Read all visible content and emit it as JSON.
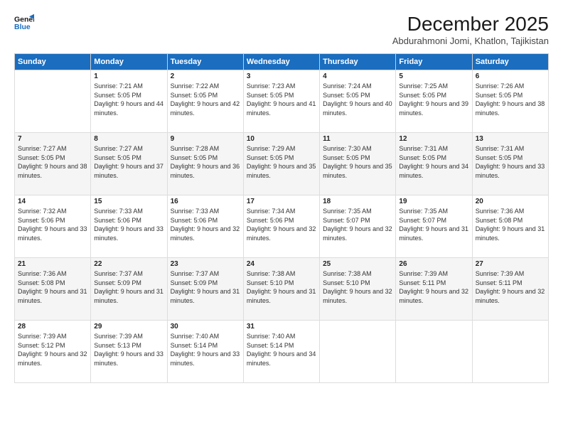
{
  "logo": {
    "line1": "General",
    "line2": "Blue"
  },
  "title": "December 2025",
  "location": "Abdurahmoni Jomi, Khatlon, Tajikistan",
  "weekdays": [
    "Sunday",
    "Monday",
    "Tuesday",
    "Wednesday",
    "Thursday",
    "Friday",
    "Saturday"
  ],
  "weeks": [
    [
      {
        "day": "",
        "sunrise": "",
        "sunset": "",
        "daylight": ""
      },
      {
        "day": "1",
        "sunrise": "Sunrise: 7:21 AM",
        "sunset": "Sunset: 5:05 PM",
        "daylight": "Daylight: 9 hours and 44 minutes."
      },
      {
        "day": "2",
        "sunrise": "Sunrise: 7:22 AM",
        "sunset": "Sunset: 5:05 PM",
        "daylight": "Daylight: 9 hours and 42 minutes."
      },
      {
        "day": "3",
        "sunrise": "Sunrise: 7:23 AM",
        "sunset": "Sunset: 5:05 PM",
        "daylight": "Daylight: 9 hours and 41 minutes."
      },
      {
        "day": "4",
        "sunrise": "Sunrise: 7:24 AM",
        "sunset": "Sunset: 5:05 PM",
        "daylight": "Daylight: 9 hours and 40 minutes."
      },
      {
        "day": "5",
        "sunrise": "Sunrise: 7:25 AM",
        "sunset": "Sunset: 5:05 PM",
        "daylight": "Daylight: 9 hours and 39 minutes."
      },
      {
        "day": "6",
        "sunrise": "Sunrise: 7:26 AM",
        "sunset": "Sunset: 5:05 PM",
        "daylight": "Daylight: 9 hours and 38 minutes."
      }
    ],
    [
      {
        "day": "7",
        "sunrise": "Sunrise: 7:27 AM",
        "sunset": "Sunset: 5:05 PM",
        "daylight": "Daylight: 9 hours and 38 minutes."
      },
      {
        "day": "8",
        "sunrise": "Sunrise: 7:27 AM",
        "sunset": "Sunset: 5:05 PM",
        "daylight": "Daylight: 9 hours and 37 minutes."
      },
      {
        "day": "9",
        "sunrise": "Sunrise: 7:28 AM",
        "sunset": "Sunset: 5:05 PM",
        "daylight": "Daylight: 9 hours and 36 minutes."
      },
      {
        "day": "10",
        "sunrise": "Sunrise: 7:29 AM",
        "sunset": "Sunset: 5:05 PM",
        "daylight": "Daylight: 9 hours and 35 minutes."
      },
      {
        "day": "11",
        "sunrise": "Sunrise: 7:30 AM",
        "sunset": "Sunset: 5:05 PM",
        "daylight": "Daylight: 9 hours and 35 minutes."
      },
      {
        "day": "12",
        "sunrise": "Sunrise: 7:31 AM",
        "sunset": "Sunset: 5:05 PM",
        "daylight": "Daylight: 9 hours and 34 minutes."
      },
      {
        "day": "13",
        "sunrise": "Sunrise: 7:31 AM",
        "sunset": "Sunset: 5:05 PM",
        "daylight": "Daylight: 9 hours and 33 minutes."
      }
    ],
    [
      {
        "day": "14",
        "sunrise": "Sunrise: 7:32 AM",
        "sunset": "Sunset: 5:06 PM",
        "daylight": "Daylight: 9 hours and 33 minutes."
      },
      {
        "day": "15",
        "sunrise": "Sunrise: 7:33 AM",
        "sunset": "Sunset: 5:06 PM",
        "daylight": "Daylight: 9 hours and 33 minutes."
      },
      {
        "day": "16",
        "sunrise": "Sunrise: 7:33 AM",
        "sunset": "Sunset: 5:06 PM",
        "daylight": "Daylight: 9 hours and 32 minutes."
      },
      {
        "day": "17",
        "sunrise": "Sunrise: 7:34 AM",
        "sunset": "Sunset: 5:06 PM",
        "daylight": "Daylight: 9 hours and 32 minutes."
      },
      {
        "day": "18",
        "sunrise": "Sunrise: 7:35 AM",
        "sunset": "Sunset: 5:07 PM",
        "daylight": "Daylight: 9 hours and 32 minutes."
      },
      {
        "day": "19",
        "sunrise": "Sunrise: 7:35 AM",
        "sunset": "Sunset: 5:07 PM",
        "daylight": "Daylight: 9 hours and 31 minutes."
      },
      {
        "day": "20",
        "sunrise": "Sunrise: 7:36 AM",
        "sunset": "Sunset: 5:08 PM",
        "daylight": "Daylight: 9 hours and 31 minutes."
      }
    ],
    [
      {
        "day": "21",
        "sunrise": "Sunrise: 7:36 AM",
        "sunset": "Sunset: 5:08 PM",
        "daylight": "Daylight: 9 hours and 31 minutes."
      },
      {
        "day": "22",
        "sunrise": "Sunrise: 7:37 AM",
        "sunset": "Sunset: 5:09 PM",
        "daylight": "Daylight: 9 hours and 31 minutes."
      },
      {
        "day": "23",
        "sunrise": "Sunrise: 7:37 AM",
        "sunset": "Sunset: 5:09 PM",
        "daylight": "Daylight: 9 hours and 31 minutes."
      },
      {
        "day": "24",
        "sunrise": "Sunrise: 7:38 AM",
        "sunset": "Sunset: 5:10 PM",
        "daylight": "Daylight: 9 hours and 31 minutes."
      },
      {
        "day": "25",
        "sunrise": "Sunrise: 7:38 AM",
        "sunset": "Sunset: 5:10 PM",
        "daylight": "Daylight: 9 hours and 32 minutes."
      },
      {
        "day": "26",
        "sunrise": "Sunrise: 7:39 AM",
        "sunset": "Sunset: 5:11 PM",
        "daylight": "Daylight: 9 hours and 32 minutes."
      },
      {
        "day": "27",
        "sunrise": "Sunrise: 7:39 AM",
        "sunset": "Sunset: 5:11 PM",
        "daylight": "Daylight: 9 hours and 32 minutes."
      }
    ],
    [
      {
        "day": "28",
        "sunrise": "Sunrise: 7:39 AM",
        "sunset": "Sunset: 5:12 PM",
        "daylight": "Daylight: 9 hours and 32 minutes."
      },
      {
        "day": "29",
        "sunrise": "Sunrise: 7:39 AM",
        "sunset": "Sunset: 5:13 PM",
        "daylight": "Daylight: 9 hours and 33 minutes."
      },
      {
        "day": "30",
        "sunrise": "Sunrise: 7:40 AM",
        "sunset": "Sunset: 5:14 PM",
        "daylight": "Daylight: 9 hours and 33 minutes."
      },
      {
        "day": "31",
        "sunrise": "Sunrise: 7:40 AM",
        "sunset": "Sunset: 5:14 PM",
        "daylight": "Daylight: 9 hours and 34 minutes."
      },
      {
        "day": "",
        "sunrise": "",
        "sunset": "",
        "daylight": ""
      },
      {
        "day": "",
        "sunrise": "",
        "sunset": "",
        "daylight": ""
      },
      {
        "day": "",
        "sunrise": "",
        "sunset": "",
        "daylight": ""
      }
    ]
  ]
}
